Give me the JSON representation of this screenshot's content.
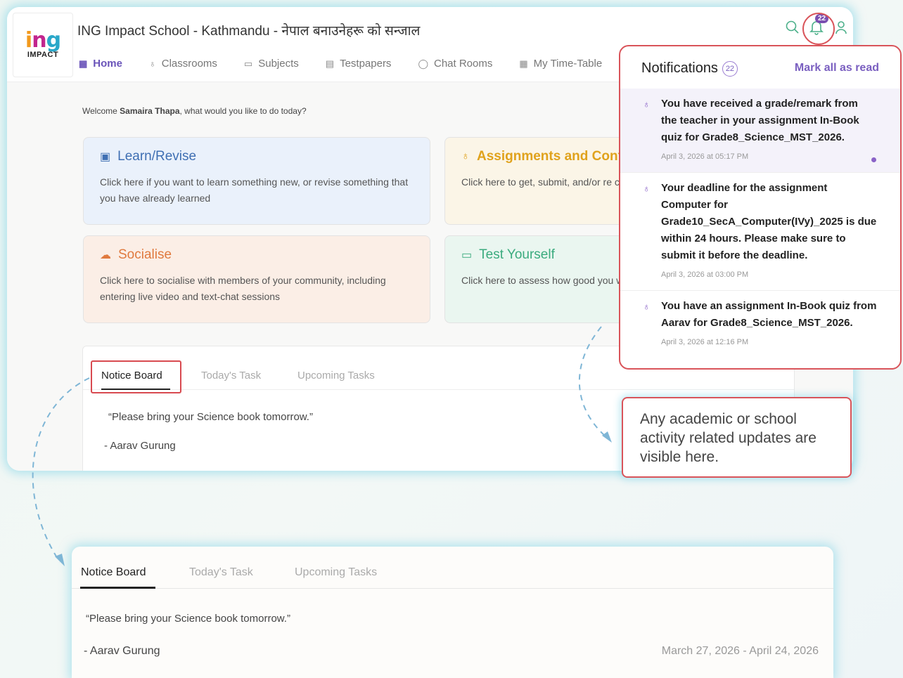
{
  "school_title": "ING Impact School - Kathmandu - नेपाल बनाउनेहरू को सन्जाल",
  "logo": {
    "word_1": "i",
    "word_2": "n",
    "word_3": "g",
    "sub": "IMPACT"
  },
  "nav": [
    {
      "label": "Home",
      "icon": "grid-icon"
    },
    {
      "label": "Classrooms",
      "icon": "apple-icon"
    },
    {
      "label": "Subjects",
      "icon": "book-icon"
    },
    {
      "label": "Testpapers",
      "icon": "paper-icon"
    },
    {
      "label": "Chat Rooms",
      "icon": "chat-icon"
    },
    {
      "label": "My Time-Table",
      "icon": "calendar-icon"
    }
  ],
  "notif_badge": "22",
  "welcome": {
    "prefix": "Welcome",
    "name": "Samaira Thapa",
    "suffix": ", what would you like to do today?"
  },
  "cards": {
    "learn": {
      "title": "Learn/Revise",
      "desc": "Click here if you want to learn something new, or revise something that you have already learned"
    },
    "assign": {
      "title": "Assignments and Cont",
      "desc": "Click here to get, submit, and/or re contents that your teacher may ha"
    },
    "social": {
      "title": "Socialise",
      "desc": "Click here to socialise with members of your community, including entering live video and text-chat sessions"
    },
    "test": {
      "title": "Test Yourself",
      "desc": "Click here to assess how good you weakness so that you can directly"
    }
  },
  "notice": {
    "tabs": [
      "Notice Board",
      "Today's Task",
      "Upcoming Tasks"
    ],
    "quote": "“Please bring your Science book tomorrow.”",
    "author": "- Aarav Gurung",
    "dates": "March 27, 2026 - April 24, 2026"
  },
  "notifications": {
    "title": "Notifications",
    "count": "22",
    "mark_all": "Mark all as read",
    "items": [
      {
        "text": "You have received a grade/remark from the teacher in your assignment In-Book quiz for Grade8_Science_MST_2026.",
        "time": "April 3, 2026 at 05:17 PM"
      },
      {
        "text": "Your deadline for the assignment Computer for Grade10_SecA_Computer(IVy)_2025 is due within 24 hours. Please make sure to submit it before the deadline.",
        "time": "April 3, 2026 at 03:00 PM"
      },
      {
        "text": "You have an assignment In-Book quiz from Aarav for Grade8_Science_MST_2026.",
        "time": "April 3, 2026 at 12:16 PM"
      }
    ]
  },
  "callout": "Any academic or school activity related updates are visible here.",
  "colors": {
    "accent": "#6a54b9",
    "highlight": "#d9545a",
    "glow": "#78d2e6"
  }
}
